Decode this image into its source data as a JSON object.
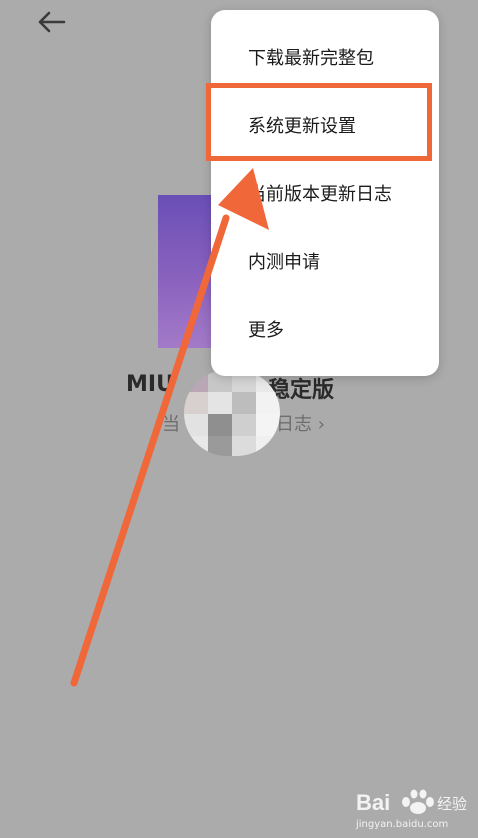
{
  "header": {
    "back_icon": "arrow-left-icon"
  },
  "main": {
    "version_title_left": "MIU",
    "version_title_right": "稳定版",
    "changelog_left": "当",
    "changelog_right": "日志 ›"
  },
  "menu": {
    "items": [
      {
        "label": "下载最新完整包"
      },
      {
        "label": "系统更新设置",
        "highlighted": true
      },
      {
        "label": "当前版本更新日志"
      },
      {
        "label": "内测申请"
      },
      {
        "label": "更多"
      }
    ]
  },
  "annotation": {
    "color": "#f0673a"
  },
  "watermark": {
    "brand": "Bai",
    "suffix": "经验",
    "url": "jingyan.baidu.com"
  }
}
